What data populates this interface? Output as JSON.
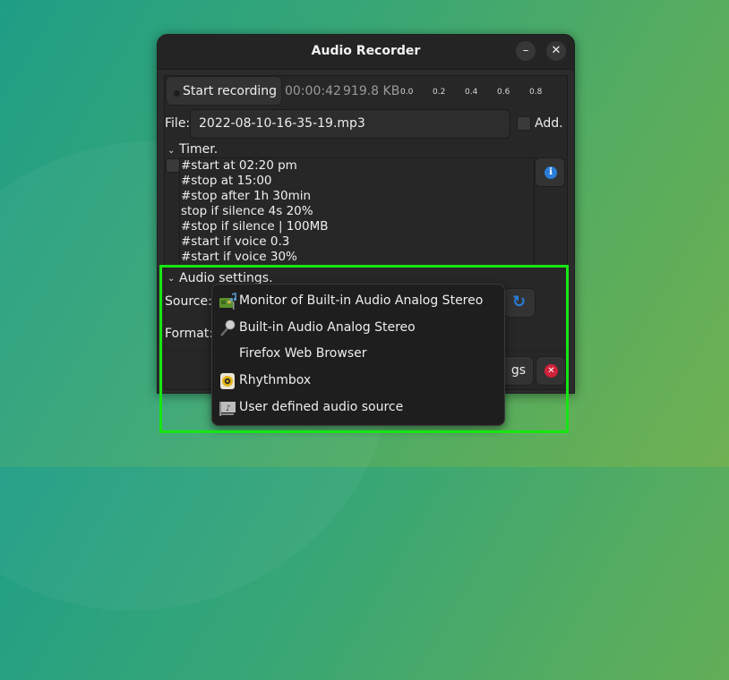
{
  "window": {
    "title": "Audio Recorder",
    "minimize_glyph": "–",
    "close_glyph": "✕"
  },
  "recorder": {
    "start_label": "Start recording",
    "elapsed": "00:00:42",
    "size": "919.8 KB",
    "level_ticks": [
      "0.0",
      "0.2",
      "0.4",
      "0.6",
      "0.8"
    ]
  },
  "file": {
    "label": "File:",
    "value": "2022-08-10-16-35-19.mp3",
    "add_label": "Add.",
    "add_checked": false
  },
  "timer": {
    "header": "Timer.",
    "enabled": false,
    "lines": [
      "#start at 02:20 pm",
      "#stop at 15:00",
      "#stop after 1h 30min",
      "stop if silence 4s 20%",
      "#stop if silence | 100MB",
      "#start if voice 0.3",
      "#start if voice 30%"
    ],
    "info_icon": "info-icon"
  },
  "audio_settings": {
    "header": "Audio settings.",
    "source_label": "Source:",
    "format_label": "Format:",
    "refresh_icon": "refresh-icon",
    "settings_button_partial": "gs",
    "close_icon": "close-circle-icon"
  },
  "source_menu": {
    "items": [
      {
        "label": "Monitor of Built-in Audio Analog Stereo",
        "icon": "sound-card-icon"
      },
      {
        "label": "Built-in Audio Analog Stereo",
        "icon": "microphone-icon"
      },
      {
        "label": "Firefox Web Browser",
        "icon": ""
      },
      {
        "label": "Rhythmbox",
        "icon": "rhythmbox-icon"
      },
      {
        "label": "User defined audio source",
        "icon": "user-audio-source-icon"
      }
    ]
  },
  "colors": {
    "accent_blue": "#2a7ed8",
    "danger_red": "#d1213a",
    "highlight_green": "#16e612"
  }
}
